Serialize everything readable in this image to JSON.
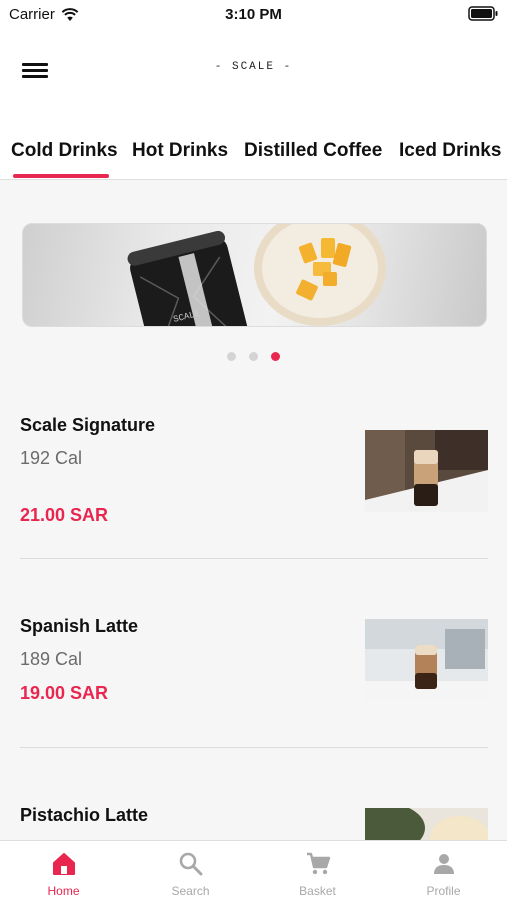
{
  "status_bar": {
    "carrier": "Carrier",
    "time": "3:10 PM"
  },
  "header": {
    "logo": "- SCALE -"
  },
  "tabs": [
    {
      "label": "Cold Drinks"
    },
    {
      "label": "Hot Drinks"
    },
    {
      "label": "Distilled Coffee"
    },
    {
      "label": "Iced Drinks"
    }
  ],
  "banner": {
    "slide_count": 3,
    "active_slide": 3,
    "can_text": "SCALE"
  },
  "items": [
    {
      "name": "Scale Signature",
      "calories": "192 Cal",
      "price": "21.00 SAR"
    },
    {
      "name": "Spanish Latte",
      "calories": "189 Cal",
      "price": "19.00 SAR"
    },
    {
      "name": "Pistachio Latte",
      "calories": "",
      "price": ""
    }
  ],
  "bottom_nav": [
    {
      "label": "Home",
      "icon": "home-icon"
    },
    {
      "label": "Search",
      "icon": "search-icon"
    },
    {
      "label": "Basket",
      "icon": "cart-icon"
    },
    {
      "label": "Profile",
      "icon": "person-icon"
    }
  ],
  "colors": {
    "accent": "#e8264f",
    "inactive": "#a8a8a8",
    "text": "#111111",
    "muted": "#6b6b6b"
  }
}
